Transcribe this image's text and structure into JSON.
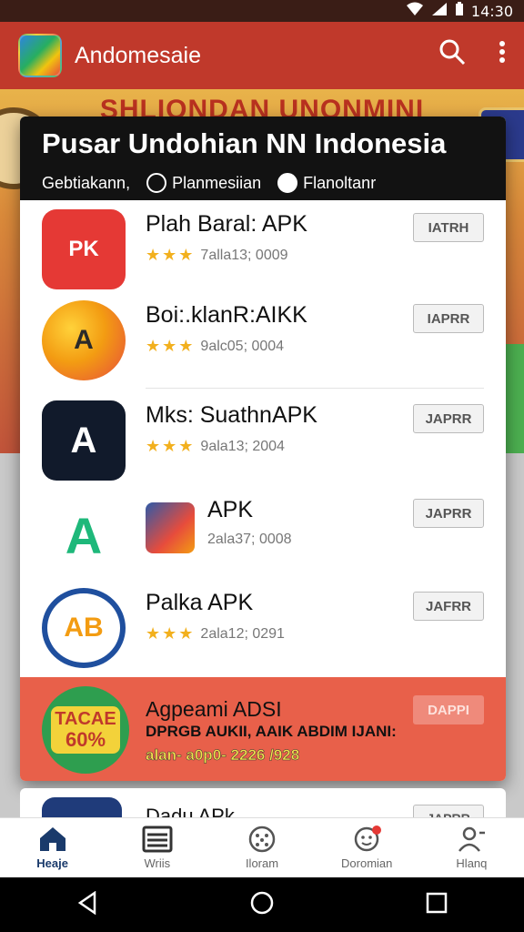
{
  "status_bar": {
    "time": "14:30"
  },
  "app_bar": {
    "title": "Andomesaie"
  },
  "hero": {
    "headline": "SHLIONDAN UNONMINI"
  },
  "popup": {
    "title": "Pusar Undohian NN Indonesia",
    "chips": [
      "Gebtiakann,",
      "Planmesiian",
      "Flanoltanr"
    ]
  },
  "apps": [
    {
      "name": "Plah Baral: APK",
      "rating_text": "7alla13; 0009",
      "button": "IATRH",
      "icon_text": "PK",
      "icon_color": "#e53935"
    },
    {
      "name": "Boi:.klanR:AIKK",
      "rating_text": "9alc05; 0004",
      "button": "IAPRR",
      "icon_text": "A",
      "icon_color": "#f4a321"
    },
    {
      "name": "Mks: SuathnAPK",
      "rating_text": "9ala13; 2004",
      "button": "JAPRR",
      "icon_text": "A",
      "icon_color": "#111a2b"
    },
    {
      "name": "APK",
      "rating_text": "2ala37; 0008",
      "button": "JAPRR",
      "icon_text": "A",
      "icon_color": "#1eb87a"
    },
    {
      "name": "Palka APK",
      "rating_text": "2ala12; 0291",
      "button": "JAFRR",
      "icon_text": "AB",
      "icon_color": "#1f4f9e"
    }
  ],
  "promo": {
    "badge_line1": "TACAE",
    "badge_line2": "60%",
    "title": "Agpeami ADSI",
    "subtitle": "DPRGB AUKII, AAIK ABDIM IJANI:",
    "code": "alan- a0p0- 2226 /928",
    "button": "DAPPI"
  },
  "peek": {
    "name": "Dadu APk",
    "button": "JAPRR"
  },
  "bottom_nav": [
    "Heaje",
    "Wriis",
    "Iloram",
    "Doromian",
    "Hlanq"
  ],
  "colors": {
    "app_bar": "#c0392b",
    "promo": "#e8604a",
    "star": "#f2b01e"
  }
}
